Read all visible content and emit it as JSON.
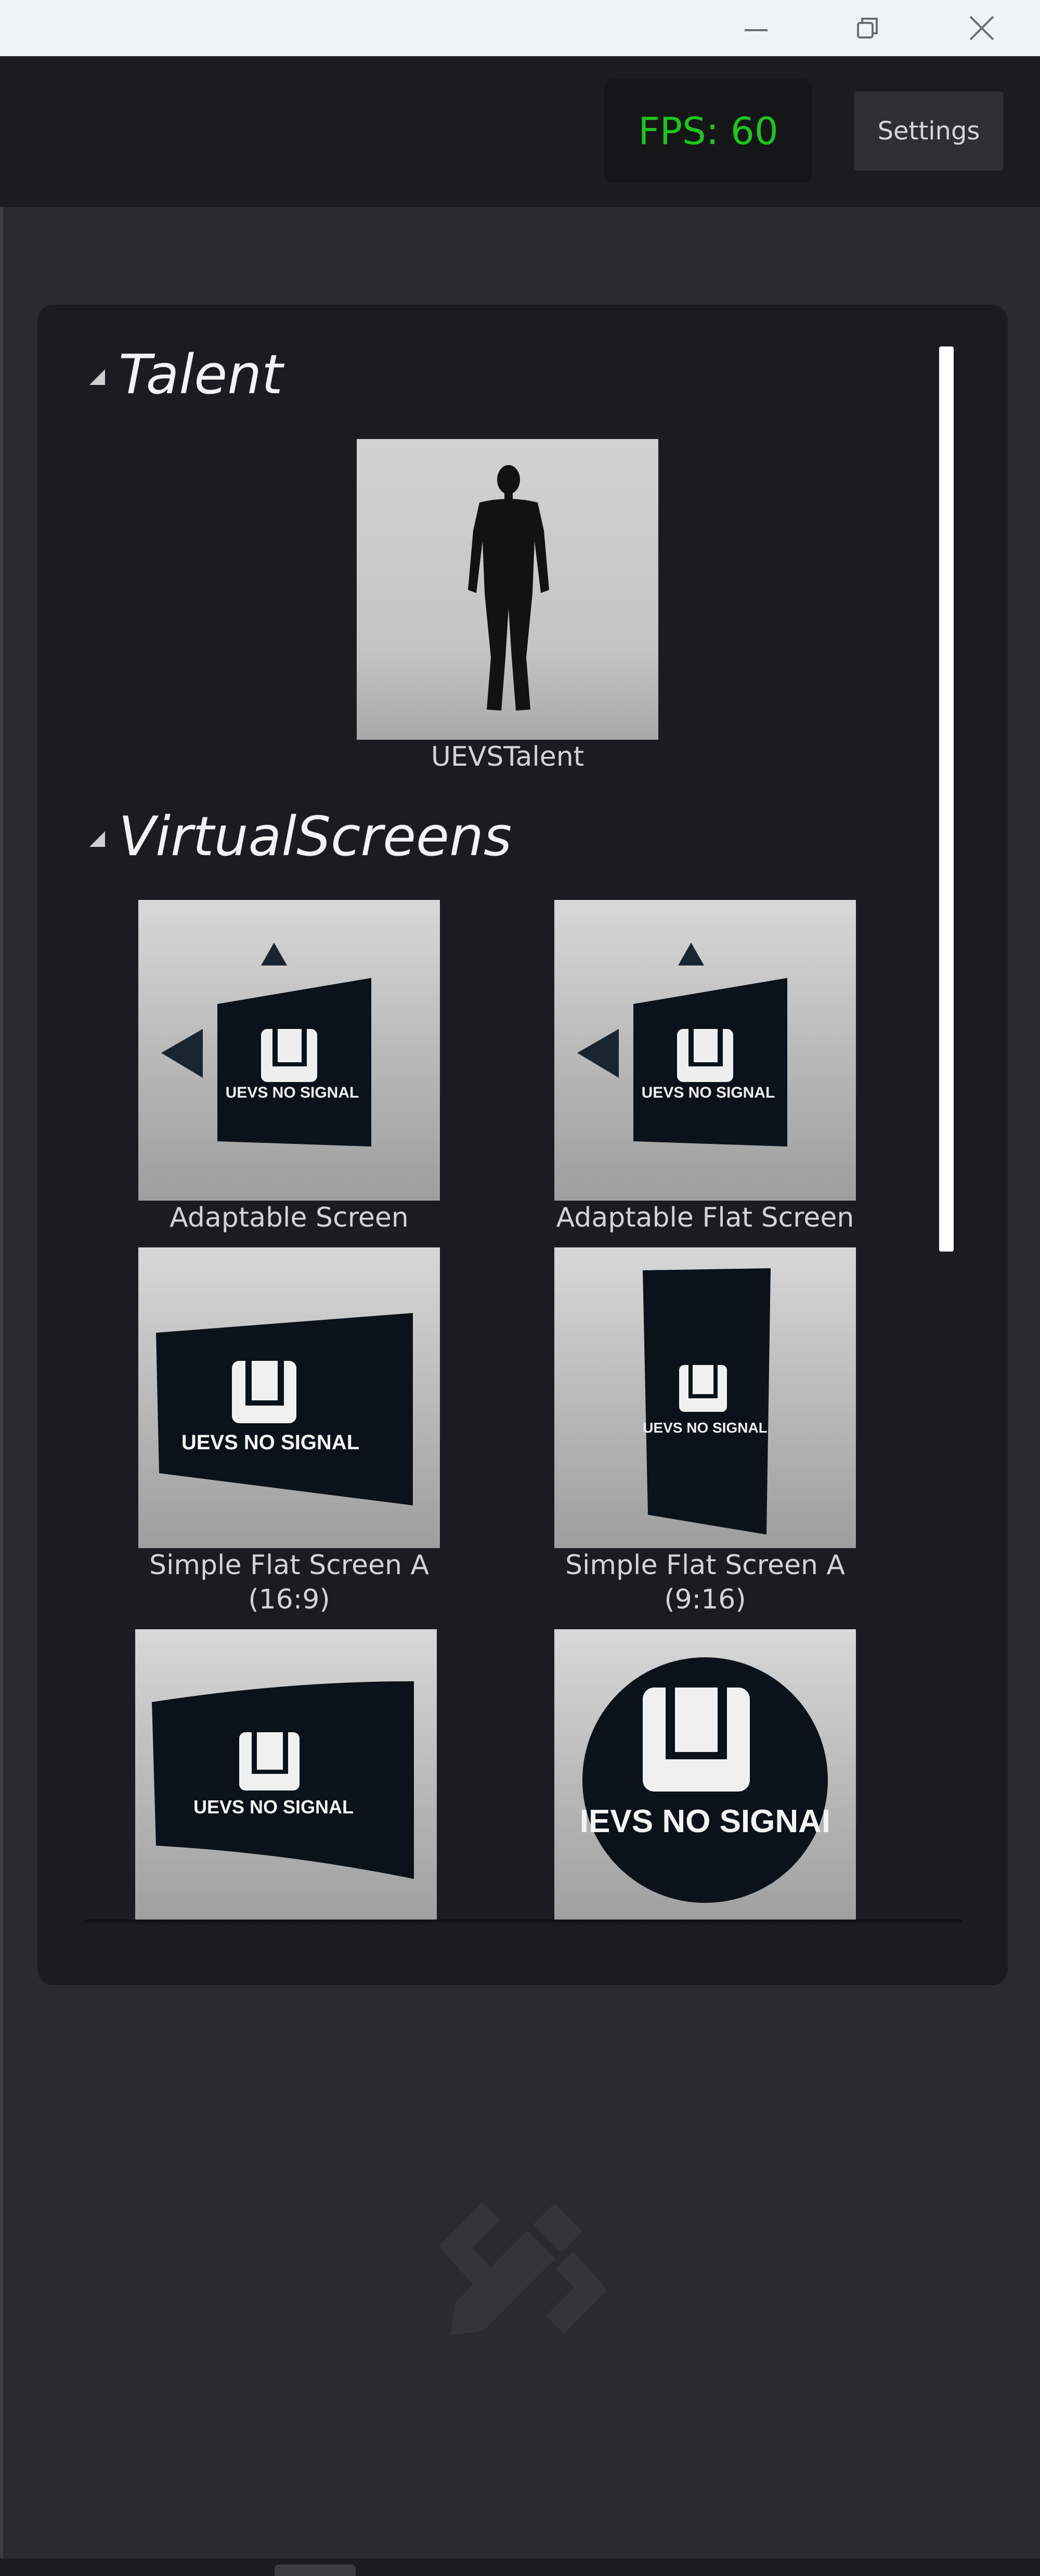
{
  "window": {
    "controls": [
      {
        "name": "minimize",
        "icon": "minimize-icon"
      },
      {
        "name": "restore",
        "icon": "restore-icon"
      },
      {
        "name": "close",
        "icon": "close-icon"
      }
    ]
  },
  "toolbar": {
    "fps_label": "FPS: 60",
    "fps_color": "#1fc31f",
    "settings_label": "Settings"
  },
  "panel": {
    "sections": [
      {
        "title": "Talent",
        "items": [
          {
            "label": "UEVSTalent",
            "icon": "person-silhouette-icon"
          }
        ]
      },
      {
        "title": "VirtualScreens",
        "items": [
          {
            "label": "Adaptable Screen",
            "thumb_text": "UEVS NO SIGNAL"
          },
          {
            "label": "Adaptable Flat Screen",
            "thumb_text": "UEVS NO SIGNAL"
          },
          {
            "label": "Simple Flat Screen A\n(16:9)",
            "thumb_text": "UEVS NO SIGNAL"
          },
          {
            "label": "Simple Flat Screen A\n(9:16)",
            "thumb_text": "UEVS NO SIGNAL"
          },
          {
            "label": "",
            "thumb_text": "UEVS NO SIGNAL"
          },
          {
            "label": "",
            "thumb_text": "IEVS NO SIGNAI"
          }
        ]
      }
    ]
  },
  "watermark": {
    "icon": "pencil-brackets-logo-icon"
  }
}
